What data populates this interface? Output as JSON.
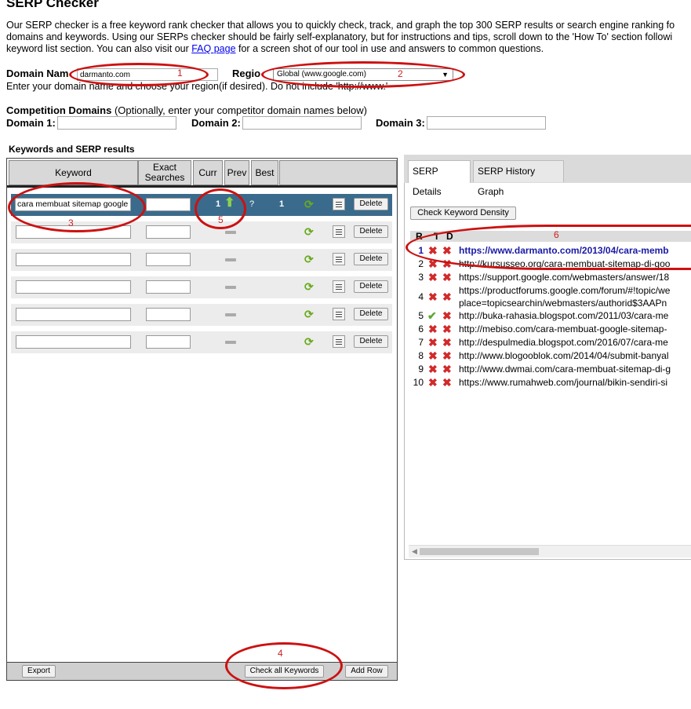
{
  "page": {
    "title": "SERP Checker",
    "intro_line1": "Our SERP checker is a free keyword rank checker that allows you to quickly check, track, and graph the top 300 SERP results or search engine ranking fo",
    "intro_line2": "domains and keywords. Using our SERPs checker should be fairly self-explanatory, but for instructions and tips, scroll down to the 'How To' section followi",
    "intro_line3a": "keyword list section. You can also visit our ",
    "intro_link": "FAQ page",
    "intro_line3b": " for a screen shot of our tool in use and answers to common questions."
  },
  "domain": {
    "label": "Domain Nam",
    "value": "darmanto.com",
    "region_label": "Regio",
    "region_value": "Global (www.google.com)",
    "hint": "Enter your domain name and choose your region(if desired). Do not include 'http://www.'"
  },
  "competition": {
    "title": "Competition Domains",
    "subtitle": " (Optionally, enter your competitor domain names below)",
    "d1": "Domain 1:",
    "d2": "Domain 2:",
    "d3": "Domain 3:"
  },
  "keywords": {
    "section_title": "Keywords and SERP results",
    "headers": {
      "keyword": "Keyword",
      "exact": "Exact Searches",
      "curr": "Curr",
      "prev": "Prev",
      "best": "Best"
    },
    "active_row": {
      "keyword": "cara membuat sitemap google",
      "curr": "1",
      "prev": "?",
      "best": "1"
    },
    "delete_label": "Delete",
    "rows_empty": 5
  },
  "footer": {
    "export": "Export",
    "check_all": "Check all Keywords",
    "add_row": "Add Row"
  },
  "serp": {
    "tab_details": "SERP Details",
    "tab_history": "SERP History Graph",
    "density_button": "Check Keyword Density",
    "col_r": "R",
    "col_t": "T",
    "col_d": "D",
    "results": [
      {
        "rank": "1",
        "t": "x",
        "d": "x",
        "url": "https://www.darmanto.com/2013/04/cara-memb",
        "own": true
      },
      {
        "rank": "2",
        "t": "x",
        "d": "x",
        "url": "http://kursusseo.org/cara-membuat-sitemap-di-goo",
        "own": false
      },
      {
        "rank": "3",
        "t": "x",
        "d": "x",
        "url": "https://support.google.com/webmasters/answer/18",
        "own": false
      },
      {
        "rank": "4",
        "t": "x",
        "d": "x",
        "url": "https://productforums.google.com/forum/#!topic/we",
        "url2": "place=topicsearchin/webmasters/authorid$3AAPn",
        "own": false
      },
      {
        "rank": "5",
        "t": "ok",
        "d": "x",
        "url": "http://buka-rahasia.blogspot.com/2011/03/cara-me",
        "own": false
      },
      {
        "rank": "6",
        "t": "x",
        "d": "x",
        "url": "http://mebiso.com/cara-membuat-google-sitemap-",
        "own": false
      },
      {
        "rank": "7",
        "t": "x",
        "d": "x",
        "url": "http://despulmedia.blogspot.com/2016/07/cara-me",
        "own": false
      },
      {
        "rank": "8",
        "t": "x",
        "d": "x",
        "url": "http://www.blogooblok.com/2014/04/submit-banyal",
        "own": false
      },
      {
        "rank": "9",
        "t": "x",
        "d": "x",
        "url": "http://www.dwmai.com/cara-membuat-sitemap-di-g",
        "own": false
      },
      {
        "rank": "10",
        "t": "x",
        "d": "x",
        "url": "https://www.rumahweb.com/journal/bikin-sendiri-si",
        "own": false
      }
    ]
  },
  "annotations": [
    "1",
    "2",
    "3",
    "4",
    "5",
    "6"
  ],
  "colors": {
    "annotation": "#cc1111",
    "active_row": "#3a6b8c",
    "link": "#0000ee"
  }
}
